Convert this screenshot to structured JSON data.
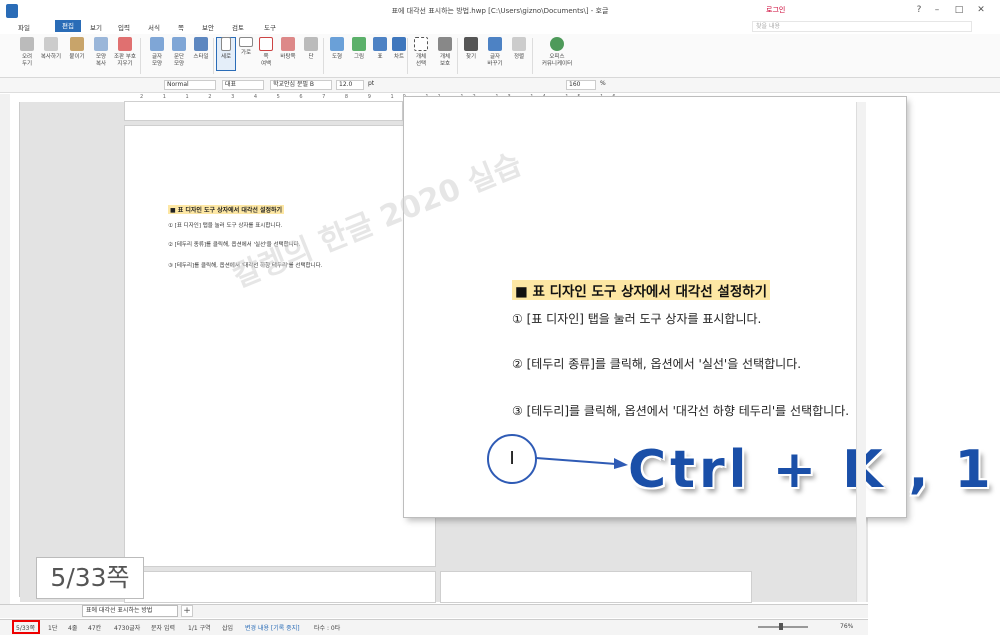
{
  "window": {
    "title": "표에 대각선 표시하는 방법.hwp [C:\\Users\\gizno\\Documents\\] - 호글",
    "login": "로그인",
    "help_placeholder": "찾을 내용",
    "controls": [
      "–",
      "□",
      "✕"
    ]
  },
  "menu": {
    "file": "파일",
    "edit": "편집",
    "items": [
      "보기",
      "입력",
      "서식",
      "쪽",
      "보안",
      "검토",
      "도구"
    ]
  },
  "ribbon": {
    "buttons": [
      {
        "label": "오려\n두기"
      },
      {
        "label": "복사하기"
      },
      {
        "label": "붙이기"
      },
      {
        "label": "모양\n복사"
      },
      {
        "label": "조판 부호\n지우기"
      },
      {
        "label": "글자\n모양"
      },
      {
        "label": "문단\n모양"
      },
      {
        "label": "스타일"
      },
      {
        "label": "세로"
      },
      {
        "label": "가로"
      },
      {
        "label": "쪽\n여백"
      },
      {
        "label": "바탕쪽"
      },
      {
        "label": "단"
      },
      {
        "label": "도형"
      },
      {
        "label": "그림"
      },
      {
        "label": "표"
      },
      {
        "label": "차트"
      },
      {
        "label": "개체\n선택"
      },
      {
        "label": "개체\n보호"
      },
      {
        "label": "찾기"
      },
      {
        "label": "글자\n바꾸기"
      },
      {
        "label": "정렬"
      },
      {
        "label": "오피스\n커뮤니케이터"
      }
    ]
  },
  "format_toolbar": {
    "style": "Normal",
    "language": "대표",
    "font": "학교안심 분필 B",
    "size": "12.0",
    "unit": "pt",
    "zoom": "160",
    "zoom_unit": "%"
  },
  "ruler": {
    "numbers": "2 1 1 2 3 4 5 6 7 8 9 10 11 12 13 14 15 16"
  },
  "document": {
    "heading": "■ 표 디자인 도구 상자에서 대각선 설정하기",
    "steps": [
      "① [표 디자인] 탭을 눌러 도구 상자를 표시합니다.",
      "② [테두리 종류]를 클릭해, 옵션에서 '실선'을 선택합니다.",
      "③ [테두리]를 클릭해, 옵션에서 '대각선 하향 테두리'를 선택합니다."
    ],
    "watermark": "칼렝의 한글 2020 실습"
  },
  "overlay": {
    "cursor_symbol": "I",
    "shortcut": "Ctrl + K , 1",
    "page_callout": "5/33쪽"
  },
  "tabs": {
    "doc_tab": "표에 대각선 표시하는 방법",
    "add": "+"
  },
  "statusbar": {
    "page": "5/33쪽",
    "column": "1단",
    "line": "4줄",
    "col_pos": "47칸",
    "chars": "4730글자",
    "input_mode": "문자 입력",
    "section": "1/1 구역",
    "insert": "삽입",
    "track_changes": "변경 내용 [기록 중지]",
    "typing": "타수 : 0타",
    "zoom": "76%"
  },
  "colors": {
    "accent": "#2a6cb7",
    "highlight": "#fde7a4",
    "shortcut": "#1a4fa8",
    "status_box": "#ee0000"
  }
}
